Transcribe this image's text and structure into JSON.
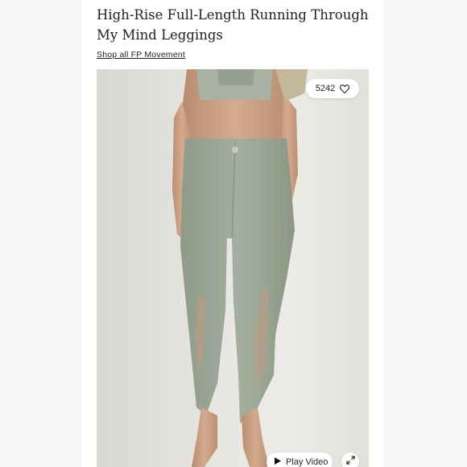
{
  "product": {
    "title": "High-Rise Full-Length Running Through My Mind Leggings",
    "shop_link": "Shop all FP Movement"
  },
  "image": {
    "likes_count": "5242",
    "like_icon": "heart-icon",
    "play_label": "Play Video",
    "play_icon": "play-icon",
    "expand_icon": "expand-icon"
  },
  "colors": {
    "leggings": "#9aa594",
    "skin": "#c99f84",
    "background": "#e8e6e1"
  }
}
